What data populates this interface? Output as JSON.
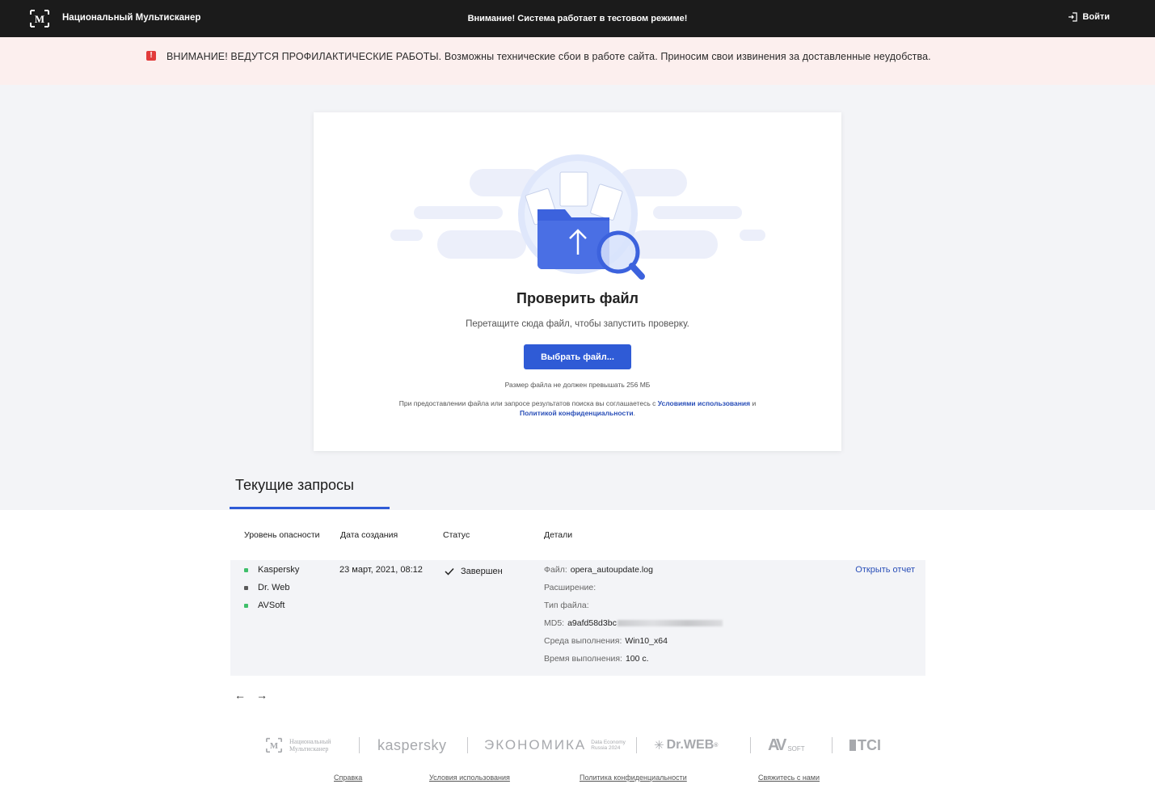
{
  "header": {
    "brand": "Национальный Мультисканер",
    "test_notice": "Внимание! Система работает в тестовом режиме!",
    "login_label": "Войти"
  },
  "maintenance": {
    "icon": "!",
    "text": "ВНИМАНИЕ! ВЕДУТСЯ ПРОФИЛАКТИЧЕСКИЕ РАБОТЫ. Возможны технические сбои в работе сайта. Приносим свои извинения за доставленные неудобства."
  },
  "upload": {
    "title": "Проверить файл",
    "subtitle": "Перетащите сюда файл, чтобы запустить проверку.",
    "button_label": "Выбрать файл...",
    "size_note": "Размер файла не должен превышать 256 МБ",
    "terms_prefix": "При предоставлении файла или запросе результатов поиска вы соглашаетесь с",
    "terms_link": "Условиями использования",
    "terms_and": "и",
    "privacy_link": "Политикой конфиденциальности",
    "terms_suffix": "."
  },
  "requests": {
    "title": "Текущие запросы",
    "columns": [
      "Уровень опасности",
      "Дата создания",
      "Статус",
      "Детали"
    ],
    "rows": [
      {
        "engines": [
          {
            "name": "Kaspersky",
            "color": "#3fbf6a"
          },
          {
            "name": "Dr. Web",
            "color": "#5a5a5a"
          },
          {
            "name": "AVSoft",
            "color": "#3fbf6a"
          }
        ],
        "date": "23 март, 2021, 08:12",
        "status": "Завершен",
        "details": {
          "file_label": "Файл:",
          "file_value": "opera_autoupdate.log",
          "ext_label": "Расширение:",
          "type_label": "Тип файла:",
          "md5_label": "MD5:",
          "md5_value": "a9afd58d3bc",
          "env_label": "Среда выполнения:",
          "env_value": "Win10_x64",
          "time_label": "Время выполнения:",
          "time_value": "100 с."
        },
        "action": "Открыть отчет"
      }
    ]
  },
  "pager": {
    "prev": "←",
    "next": "→"
  },
  "partners": {
    "nm": "Национальный Мультисканер",
    "kaspersky": "kaspersky",
    "economy": "ЭКОНОМИКА",
    "economy_sub1": "Data Economy",
    "economy_sub2": "Russia 2024",
    "drweb": "Dr.WEB",
    "avsoft": "SOFT",
    "tci": "TCI"
  },
  "footer": {
    "links": [
      "Справка",
      "Условия использования",
      "Политика конфиденциальности",
      "Свяжитесь с нами"
    ]
  },
  "colors": {
    "accent": "#2f5bd6",
    "link": "#2a4fb8",
    "header_bg": "#1b1b1b",
    "warning_bg": "#fcefee",
    "warning_icon": "#e23b3b"
  }
}
